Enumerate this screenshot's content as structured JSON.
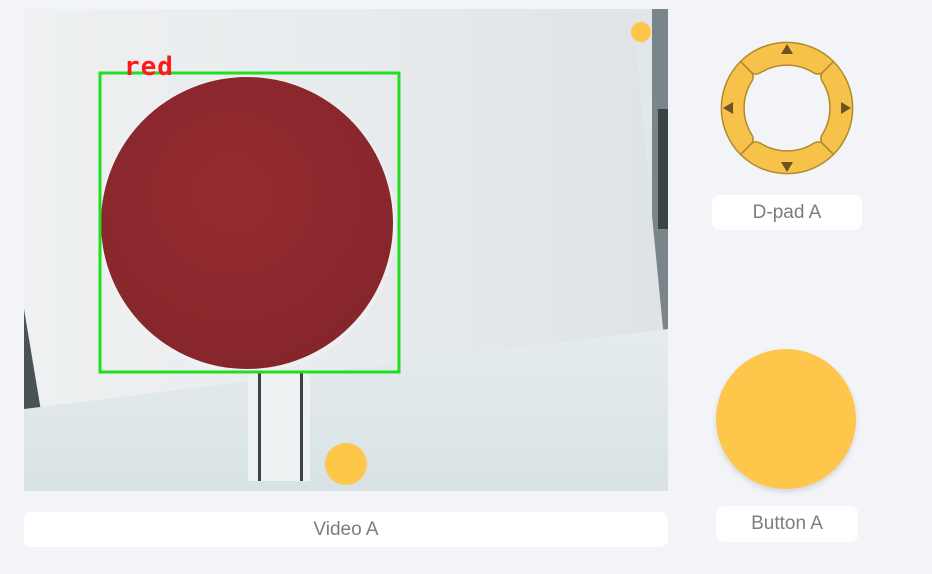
{
  "video": {
    "caption": "Video A",
    "detection_label": "red"
  },
  "dpad": {
    "caption": "D-pad A"
  },
  "button": {
    "caption": "Button A"
  },
  "colors": {
    "accent": "#fec64a",
    "detection_box": "#22dd22",
    "detection_label": "#ff1a1a",
    "target_disc": "#8e2a2e",
    "page_bg": "#f3f4f8"
  }
}
